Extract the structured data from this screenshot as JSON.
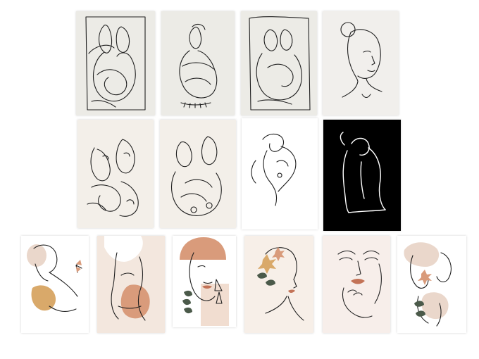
{
  "gallery": {
    "rows": [
      {
        "name": "row-1",
        "cards": [
          {
            "name": "card-couple-embrace-sketch",
            "bg": "#ecebe6"
          },
          {
            "name": "card-seated-figure-hugging-knees",
            "bg": "#ecebe6"
          },
          {
            "name": "card-couple-kiss-sketch",
            "bg": "#ecebe6"
          },
          {
            "name": "card-woman-portrait-bun",
            "bg": "#f1efec"
          }
        ]
      },
      {
        "name": "row-2",
        "cards": [
          {
            "name": "card-abstract-couple-faces",
            "bg": "#f3efe9"
          },
          {
            "name": "card-abstract-couple-bodies",
            "bg": "#f3efe9"
          },
          {
            "name": "card-reclining-torso",
            "bg": "#ffffff"
          },
          {
            "name": "card-back-silhouette-black",
            "bg": "#000000"
          }
        ]
      },
      {
        "name": "row-3",
        "cards": [
          {
            "name": "card-woman-butterfly",
            "bg": "#ffffff"
          },
          {
            "name": "card-torso-terracotta",
            "bg": "#f3e7de"
          },
          {
            "name": "card-face-earring-arch",
            "bg": "#ffffff"
          },
          {
            "name": "card-woman-floral-crown",
            "bg": "#f7efe8"
          },
          {
            "name": "card-face-hand-lips",
            "bg": "#f7eeea"
          },
          {
            "name": "card-couple-flowers",
            "bg": "#ffffff"
          }
        ]
      }
    ],
    "colors": {
      "terracotta": "#d99b7b",
      "ochre": "#d9a96a",
      "blush": "#ead7cb",
      "leaf": "#4b5a4a",
      "ink": "#1f1f1f"
    }
  }
}
